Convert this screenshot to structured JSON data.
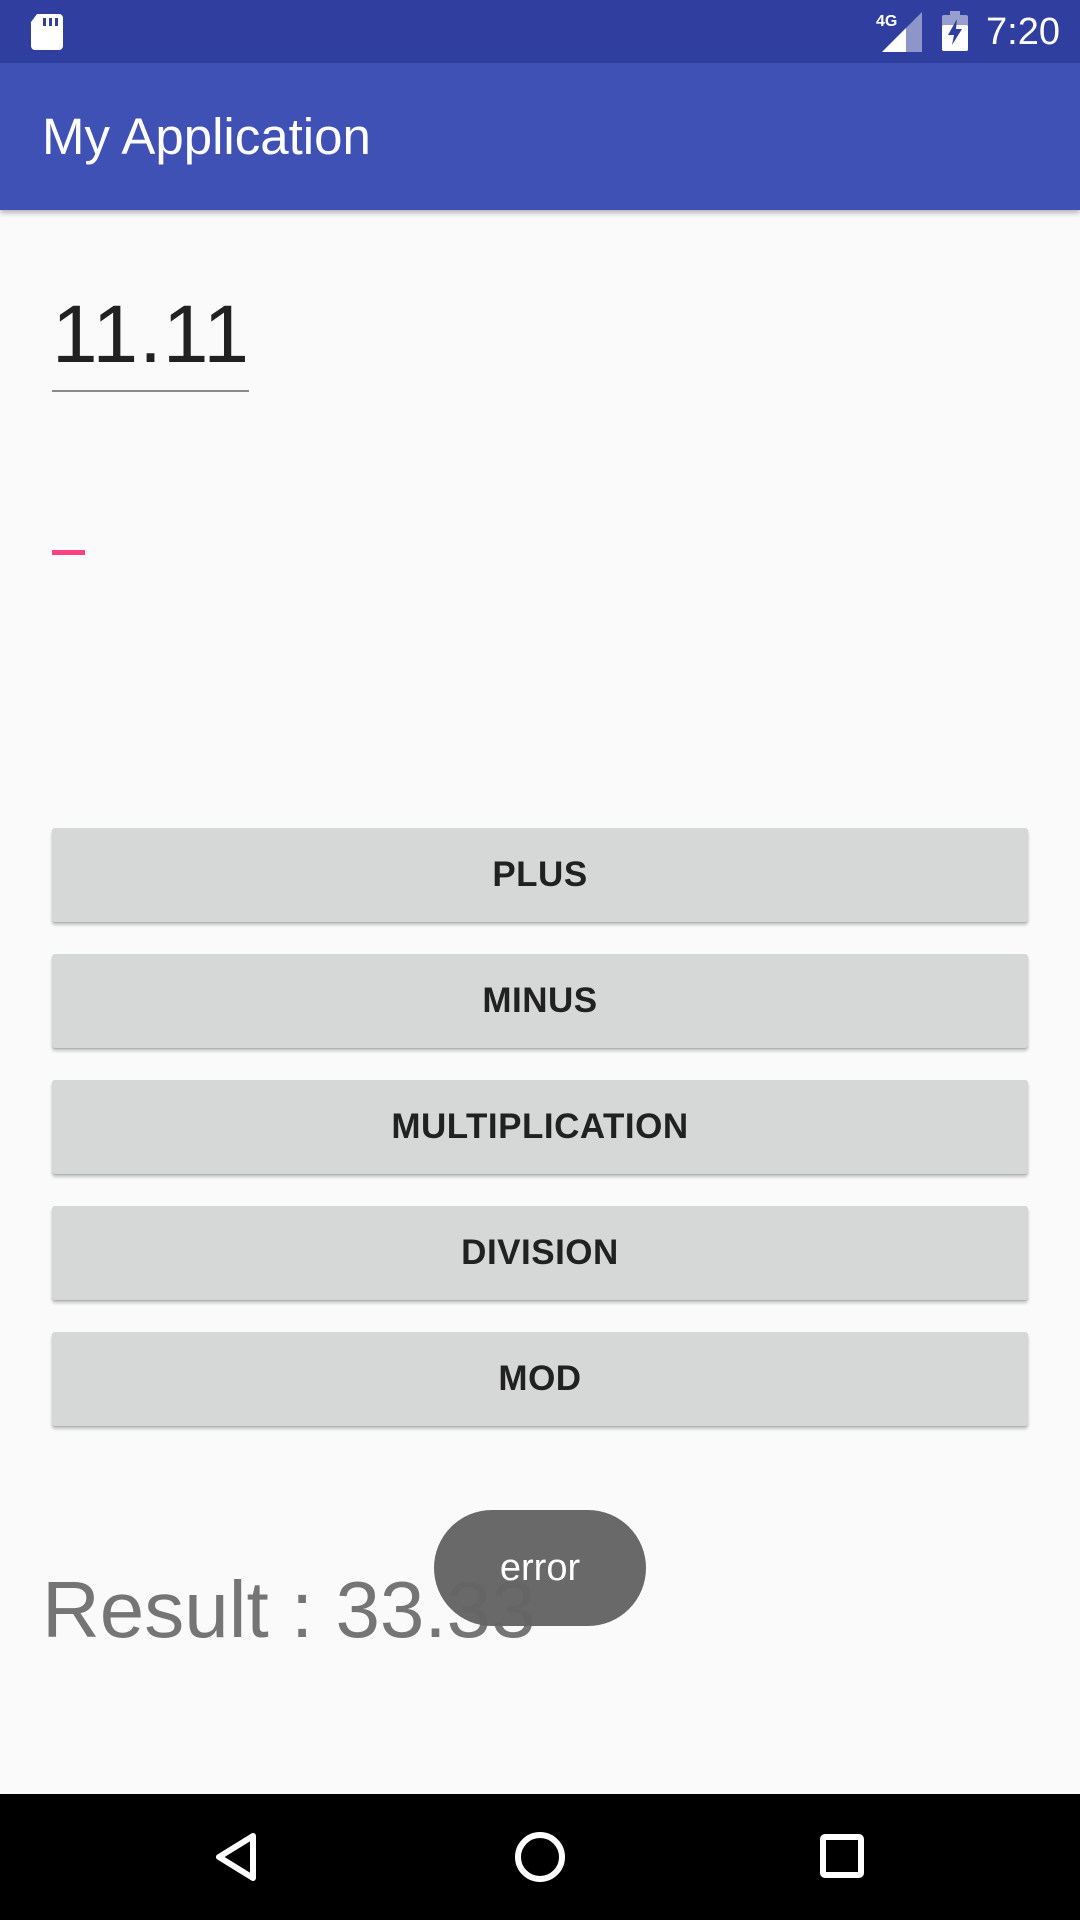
{
  "status_bar": {
    "time": "7:20",
    "network_label": "4G",
    "icons": [
      "sd-card-icon",
      "signal-4g-icon",
      "battery-charging-icon"
    ]
  },
  "app_bar": {
    "title": "My Application"
  },
  "inputs": {
    "first_number_value": "11.11",
    "second_number_value": ""
  },
  "buttons": {
    "plus": "PLUS",
    "minus": "MINUS",
    "multiplication": "MULTIPLICATION",
    "division": "DIVISION",
    "mod": "MOD"
  },
  "result": {
    "text": "Result : 33.33"
  },
  "toast": {
    "message": "error"
  },
  "nav_bar": {
    "icons": [
      "back-icon",
      "home-icon",
      "recents-icon"
    ]
  },
  "colors": {
    "status_bar": "#303f9f",
    "app_bar": "#3f51b5",
    "accent": "#ff4081",
    "button": "#d6d7d7",
    "background": "#fafafa"
  }
}
